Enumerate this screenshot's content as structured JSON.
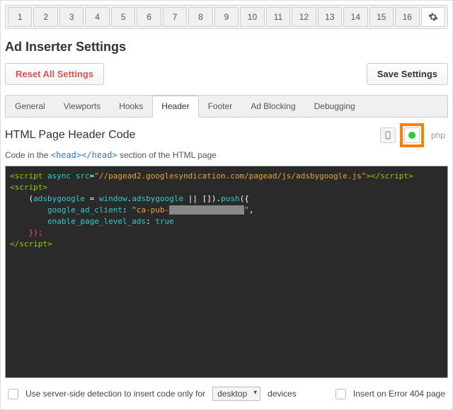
{
  "numTabs": [
    "1",
    "2",
    "3",
    "4",
    "5",
    "6",
    "7",
    "8",
    "9",
    "10",
    "11",
    "12",
    "13",
    "14",
    "15",
    "16"
  ],
  "title": "Ad Inserter Settings",
  "buttons": {
    "reset": "Reset All Settings",
    "save": "Save Settings"
  },
  "secTabs": [
    "General",
    "Viewports",
    "Hooks",
    "Header",
    "Footer",
    "Ad Blocking",
    "Debugging"
  ],
  "activeSecTab": "Header",
  "h2": "HTML Page Header Code",
  "phpLabel": "php",
  "sub": {
    "a": "Code in the ",
    "tag": "<head></head>",
    "b": " section of the HTML page"
  },
  "code": {
    "l1a": "<script",
    "l1b": " async src",
    "l1c": "=",
    "l1d": "\"//pagead2.googlesyndication.com/pagead/js/adsbygoogle.js\"",
    "l1e": "></",
    "l1f": "script",
    "l1g": ">",
    "l2a": "<script>",
    "l3a": "    (",
    "l3b": "adsbygoogle",
    "l3c": " = ",
    "l3d": "window",
    "l3e": ".",
    "l3f": "adsbygoogle",
    "l3g": " || []).",
    "l3h": "push",
    "l3i": "({",
    "l4a": "        google_ad_client",
    "l4b": ": ",
    "l4c": "\"ca-pub-",
    "l4d": "████████████████",
    "l4e": "\"",
    "l4f": ",",
    "l5a": "        enable_page_level_ads",
    "l5b": ": ",
    "l5c": "true",
    "l6": "    });",
    "l7a": "</",
    "l7b": "script",
    "l7c": ">"
  },
  "bottom": {
    "serverSide": "Use server-side detection to insert code only for",
    "deviceSel": "desktop",
    "devicesWord": "devices",
    "insert404": "Insert on Error 404 page"
  }
}
